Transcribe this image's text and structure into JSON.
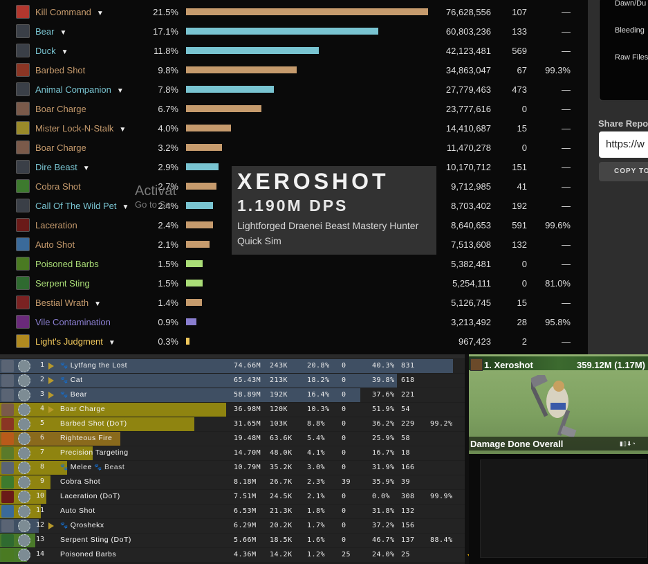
{
  "colors": {
    "hunter": "#abd473",
    "pet": "#79c4d1",
    "physical": "#c69b6d",
    "nature": "#aadd77",
    "shadow": "#8a7ed0",
    "holy": "#f0c85c",
    "bottom_pet_fill": "#3f4f63",
    "bottom_phys_fill": "#a88e10"
  },
  "spells": [
    {
      "name": "Kill Command",
      "dropdown": true,
      "pct": "21.5%",
      "damage": "76,628,556",
      "count": "107",
      "crit": "—",
      "bar": 0.215,
      "color": "#c69b6d",
      "name_color": "#c69b6d",
      "icon": "kill-command-icon",
      "icon_color": "#b2372e"
    },
    {
      "name": "Bear",
      "dropdown": true,
      "pct": "17.1%",
      "damage": "60,803,236",
      "count": "133",
      "crit": "—",
      "bar": 0.171,
      "color": "#79c4d1",
      "name_color": "#79c4d1",
      "icon": "bear-pet-icon",
      "icon_color": "#3a3f47"
    },
    {
      "name": "Duck",
      "dropdown": true,
      "pct": "11.8%",
      "damage": "42,123,481",
      "count": "569",
      "crit": "—",
      "bar": 0.118,
      "color": "#79c4d1",
      "name_color": "#79c4d1",
      "icon": "duck-pet-icon",
      "icon_color": "#3a3f47"
    },
    {
      "name": "Barbed Shot",
      "dropdown": false,
      "pct": "9.8%",
      "damage": "34,863,047",
      "count": "67",
      "crit": "99.3%",
      "bar": 0.098,
      "color": "#c69b6d",
      "name_color": "#c69b6d",
      "icon": "barbed-shot-icon",
      "icon_color": "#8a3524"
    },
    {
      "name": "Animal Companion",
      "dropdown": true,
      "pct": "7.8%",
      "damage": "27,779,463",
      "count": "473",
      "crit": "—",
      "bar": 0.078,
      "color": "#79c4d1",
      "name_color": "#79c4d1",
      "icon": "animal-companion-icon",
      "icon_color": "#3a3f47"
    },
    {
      "name": "Boar Charge",
      "dropdown": false,
      "pct": "6.7%",
      "damage": "23,777,616",
      "count": "0",
      "crit": "—",
      "bar": 0.067,
      "color": "#c69b6d",
      "name_color": "#c69b6d",
      "icon": "boar-charge-icon",
      "icon_color": "#7a5a4a"
    },
    {
      "name": "Mister Lock-N-Stalk",
      "dropdown": true,
      "pct": "4.0%",
      "damage": "14,410,687",
      "count": "15",
      "crit": "—",
      "bar": 0.04,
      "color": "#c69b6d",
      "name_color": "#c69b6d",
      "icon": "lock-n-stalk-icon",
      "icon_color": "#9a8a2a"
    },
    {
      "name": "Boar Charge",
      "dropdown": false,
      "pct": "3.2%",
      "damage": "11,470,278",
      "count": "0",
      "crit": "—",
      "bar": 0.032,
      "color": "#c69b6d",
      "name_color": "#c69b6d",
      "icon": "boar-charge-icon",
      "icon_color": "#7a5a4a"
    },
    {
      "name": "Dire Beast",
      "dropdown": true,
      "pct": "2.9%",
      "damage": "10,170,712",
      "count": "151",
      "crit": "—",
      "bar": 0.029,
      "color": "#79c4d1",
      "name_color": "#79c4d1",
      "icon": "dire-beast-icon",
      "icon_color": "#3a3f47"
    },
    {
      "name": "Cobra Shot",
      "dropdown": false,
      "pct": "2.7%",
      "damage": "9,712,985",
      "count": "41",
      "crit": "—",
      "bar": 0.027,
      "color": "#c69b6d",
      "name_color": "#c69b6d",
      "icon": "cobra-shot-icon",
      "icon_color": "#3d7a2e"
    },
    {
      "name": "Call Of The Wild Pet",
      "dropdown": true,
      "pct": "2.4%",
      "damage": "8,703,402",
      "count": "192",
      "crit": "—",
      "bar": 0.024,
      "color": "#79c4d1",
      "name_color": "#79c4d1",
      "icon": "call-of-the-wild-icon",
      "icon_color": "#3a3f47"
    },
    {
      "name": "Laceration",
      "dropdown": false,
      "pct": "2.4%",
      "damage": "8,640,653",
      "count": "591",
      "crit": "99.6%",
      "bar": 0.024,
      "color": "#c69b6d",
      "name_color": "#c69b6d",
      "icon": "laceration-icon",
      "icon_color": "#6a1a18"
    },
    {
      "name": "Auto Shot",
      "dropdown": false,
      "pct": "2.1%",
      "damage": "7,513,608",
      "count": "132",
      "crit": "—",
      "bar": 0.021,
      "color": "#c69b6d",
      "name_color": "#c69b6d",
      "icon": "auto-shot-icon",
      "icon_color": "#3a6a9a"
    },
    {
      "name": "Poisoned Barbs",
      "dropdown": false,
      "pct": "1.5%",
      "damage": "5,382,481",
      "count": "0",
      "crit": "—",
      "bar": 0.015,
      "color": "#aadd77",
      "name_color": "#aadd77",
      "icon": "poisoned-barbs-icon",
      "icon_color": "#4a7a22"
    },
    {
      "name": "Serpent Sting",
      "dropdown": false,
      "pct": "1.5%",
      "damage": "5,254,111",
      "count": "0",
      "crit": "81.0%",
      "bar": 0.015,
      "color": "#aadd77",
      "name_color": "#aadd77",
      "icon": "serpent-sting-icon",
      "icon_color": "#2f6a30"
    },
    {
      "name": "Bestial Wrath",
      "dropdown": true,
      "pct": "1.4%",
      "damage": "5,126,745",
      "count": "15",
      "crit": "—",
      "bar": 0.014,
      "color": "#c69b6d",
      "name_color": "#c69b6d",
      "icon": "bestial-wrath-icon",
      "icon_color": "#7a2222"
    },
    {
      "name": "Vile Contamination",
      "dropdown": false,
      "pct": "0.9%",
      "damage": "3,213,492",
      "count": "28",
      "crit": "95.8%",
      "bar": 0.009,
      "color": "#8a7ed0",
      "name_color": "#8a7ed0",
      "icon": "vile-contamination-icon",
      "icon_color": "#6a2a7a"
    },
    {
      "name": "Light's Judgment",
      "dropdown": true,
      "pct": "0.3%",
      "damage": "967,423",
      "count": "2",
      "crit": "—",
      "bar": 0.003,
      "color": "#f0c85c",
      "name_color": "#f0c85c",
      "icon": "lights-judgment-icon",
      "icon_color": "#b08a20"
    }
  ],
  "overlay": {
    "name": "XEROSHOT",
    "dps": "1.190M DPS",
    "spec": "Lightforged Draenei Beast Mastery Hunter Quick Sim"
  },
  "side_panel": {
    "items": [
      "Dawn/Du",
      "Bleeding",
      "Raw Files"
    ],
    "share_label": "Share Repo",
    "url_value": "https://w",
    "copy_label": "COPY TO"
  },
  "bottom_table": {
    "rows": [
      {
        "num": "1",
        "pet": true,
        "triangle": true,
        "name": "Lytfang the Lost",
        "extra": "",
        "total": "74.66M",
        "dps": "243K",
        "pct": "20.8%",
        "casts": "0",
        "crit": "40.3%",
        "hits": "831",
        "uptime": "",
        "fill": 0.98,
        "fill_color": "#3f4f63",
        "icon": "lytfang-icon",
        "icon_color": "#5a6474"
      },
      {
        "num": "2",
        "pet": true,
        "triangle": true,
        "name": "Cat",
        "extra": "",
        "total": "65.43M",
        "dps": "213K",
        "pct": "18.2%",
        "casts": "0",
        "crit": "39.8%",
        "hits": "618",
        "uptime": "",
        "fill": 0.86,
        "fill_color": "#3f4f63",
        "icon": "cat-icon",
        "icon_color": "#5a6474"
      },
      {
        "num": "3",
        "pet": true,
        "triangle": true,
        "name": "Bear",
        "extra": "",
        "total": "58.89M",
        "dps": "192K",
        "pct": "16.4%",
        "casts": "0",
        "crit": "37.6%",
        "hits": "221",
        "uptime": "",
        "fill": 0.78,
        "fill_color": "#3f4f63",
        "icon": "bear-icon",
        "icon_color": "#5a6474"
      },
      {
        "num": "4",
        "pet": false,
        "triangle": true,
        "name": "Boar Charge",
        "extra": "",
        "total": "36.98M",
        "dps": "120K",
        "pct": "10.3%",
        "casts": "0",
        "crit": "51.9%",
        "hits": "54",
        "uptime": "",
        "fill": 0.49,
        "fill_color": "#8f8410",
        "icon": "boar-charge-icon",
        "icon_color": "#7a5a4a"
      },
      {
        "num": "5",
        "pet": false,
        "triangle": false,
        "name": "Barbed Shot (DoT)",
        "extra": "",
        "total": "31.65M",
        "dps": "103K",
        "pct": "8.8%",
        "casts": "0",
        "crit": "36.2%",
        "hits": "229",
        "uptime": "99.2%",
        "fill": 0.42,
        "fill_color": "#8f8410",
        "icon": "barbed-shot-icon",
        "icon_color": "#8a3524"
      },
      {
        "num": "6",
        "pet": false,
        "triangle": false,
        "name": "Righteous Fire",
        "extra": "",
        "total": "19.48M",
        "dps": "63.6K",
        "pct": "5.4%",
        "casts": "0",
        "crit": "25.9%",
        "hits": "58",
        "uptime": "",
        "fill": 0.26,
        "fill_color": "#8a6a1c",
        "icon": "righteous-fire-icon",
        "icon_color": "#b85a1a"
      },
      {
        "num": "7",
        "pet": false,
        "triangle": false,
        "name": "Precision Targeting",
        "extra": "",
        "total": "14.70M",
        "dps": "48.0K",
        "pct": "4.1%",
        "casts": "0",
        "crit": "16.7%",
        "hits": "18",
        "uptime": "",
        "fill": 0.2,
        "fill_color": "#8f8410",
        "icon": "precision-targeting-icon",
        "icon_color": "#5a7a2a"
      },
      {
        "num": "8",
        "pet": true,
        "triangle": false,
        "name": "Melee",
        "extra": "Beast",
        "total": "10.79M",
        "dps": "35.2K",
        "pct": "3.0%",
        "casts": "0",
        "crit": "31.9%",
        "hits": "166",
        "uptime": "",
        "fill": 0.145,
        "fill_color": "#8f8410",
        "icon": "melee-icon",
        "icon_color": "#5a6474"
      },
      {
        "num": "9",
        "pet": false,
        "triangle": false,
        "name": "Cobra Shot",
        "extra": "",
        "total": "8.18M",
        "dps": "26.7K",
        "pct": "2.3%",
        "casts": "39",
        "crit": "35.9%",
        "hits": "39",
        "uptime": "",
        "fill": 0.11,
        "fill_color": "#8f8410",
        "icon": "cobra-shot-icon",
        "icon_color": "#3d7a2e"
      },
      {
        "num": "10",
        "pet": false,
        "triangle": false,
        "name": "Laceration (DoT)",
        "extra": "",
        "total": "7.51M",
        "dps": "24.5K",
        "pct": "2.1%",
        "casts": "0",
        "crit": "0.0%",
        "hits": "308",
        "uptime": "99.9%",
        "fill": 0.1,
        "fill_color": "#8f8410",
        "icon": "laceration-icon",
        "icon_color": "#6a1a18"
      },
      {
        "num": "11",
        "pet": false,
        "triangle": false,
        "name": "Auto Shot",
        "extra": "",
        "total": "6.53M",
        "dps": "21.3K",
        "pct": "1.8%",
        "casts": "0",
        "crit": "31.8%",
        "hits": "132",
        "uptime": "",
        "fill": 0.088,
        "fill_color": "#8f8410",
        "icon": "auto-shot-icon",
        "icon_color": "#3a6a9a"
      },
      {
        "num": "12",
        "pet": true,
        "triangle": true,
        "name": "Qroshekx",
        "extra": "",
        "total": "6.29M",
        "dps": "20.2K",
        "pct": "1.7%",
        "casts": "0",
        "crit": "37.2%",
        "hits": "156",
        "uptime": "",
        "fill": 0.084,
        "fill_color": "#3f4f63",
        "icon": "qroshekx-icon",
        "icon_color": "#5a6474"
      },
      {
        "num": "13",
        "pet": false,
        "triangle": false,
        "name": "Serpent Sting (DoT)",
        "extra": "",
        "total": "5.66M",
        "dps": "18.5K",
        "pct": "1.6%",
        "casts": "0",
        "crit": "46.7%",
        "hits": "137",
        "uptime": "88.4%",
        "fill": 0.076,
        "fill_color": "#4a7a2a",
        "icon": "serpent-sting-icon",
        "icon_color": "#2f6a30"
      },
      {
        "num": "14",
        "pet": false,
        "triangle": false,
        "name": "Poisoned Barbs",
        "extra": "",
        "total": "4.36M",
        "dps": "14.2K",
        "pct": "1.2%",
        "casts": "25",
        "crit": "24.0%",
        "hits": "25",
        "uptime": "",
        "fill": 0.058,
        "fill_color": "#4a7a2a",
        "icon": "poisoned-barbs-icon",
        "icon_color": "#4a7a22"
      }
    ]
  },
  "video": {
    "title": "1. Xeroshot",
    "damage": "359.12M (1.17M)",
    "caption": "Damage Done Overall"
  },
  "watermark": {
    "line1": "Activat",
    "line2": "Go to Se"
  }
}
